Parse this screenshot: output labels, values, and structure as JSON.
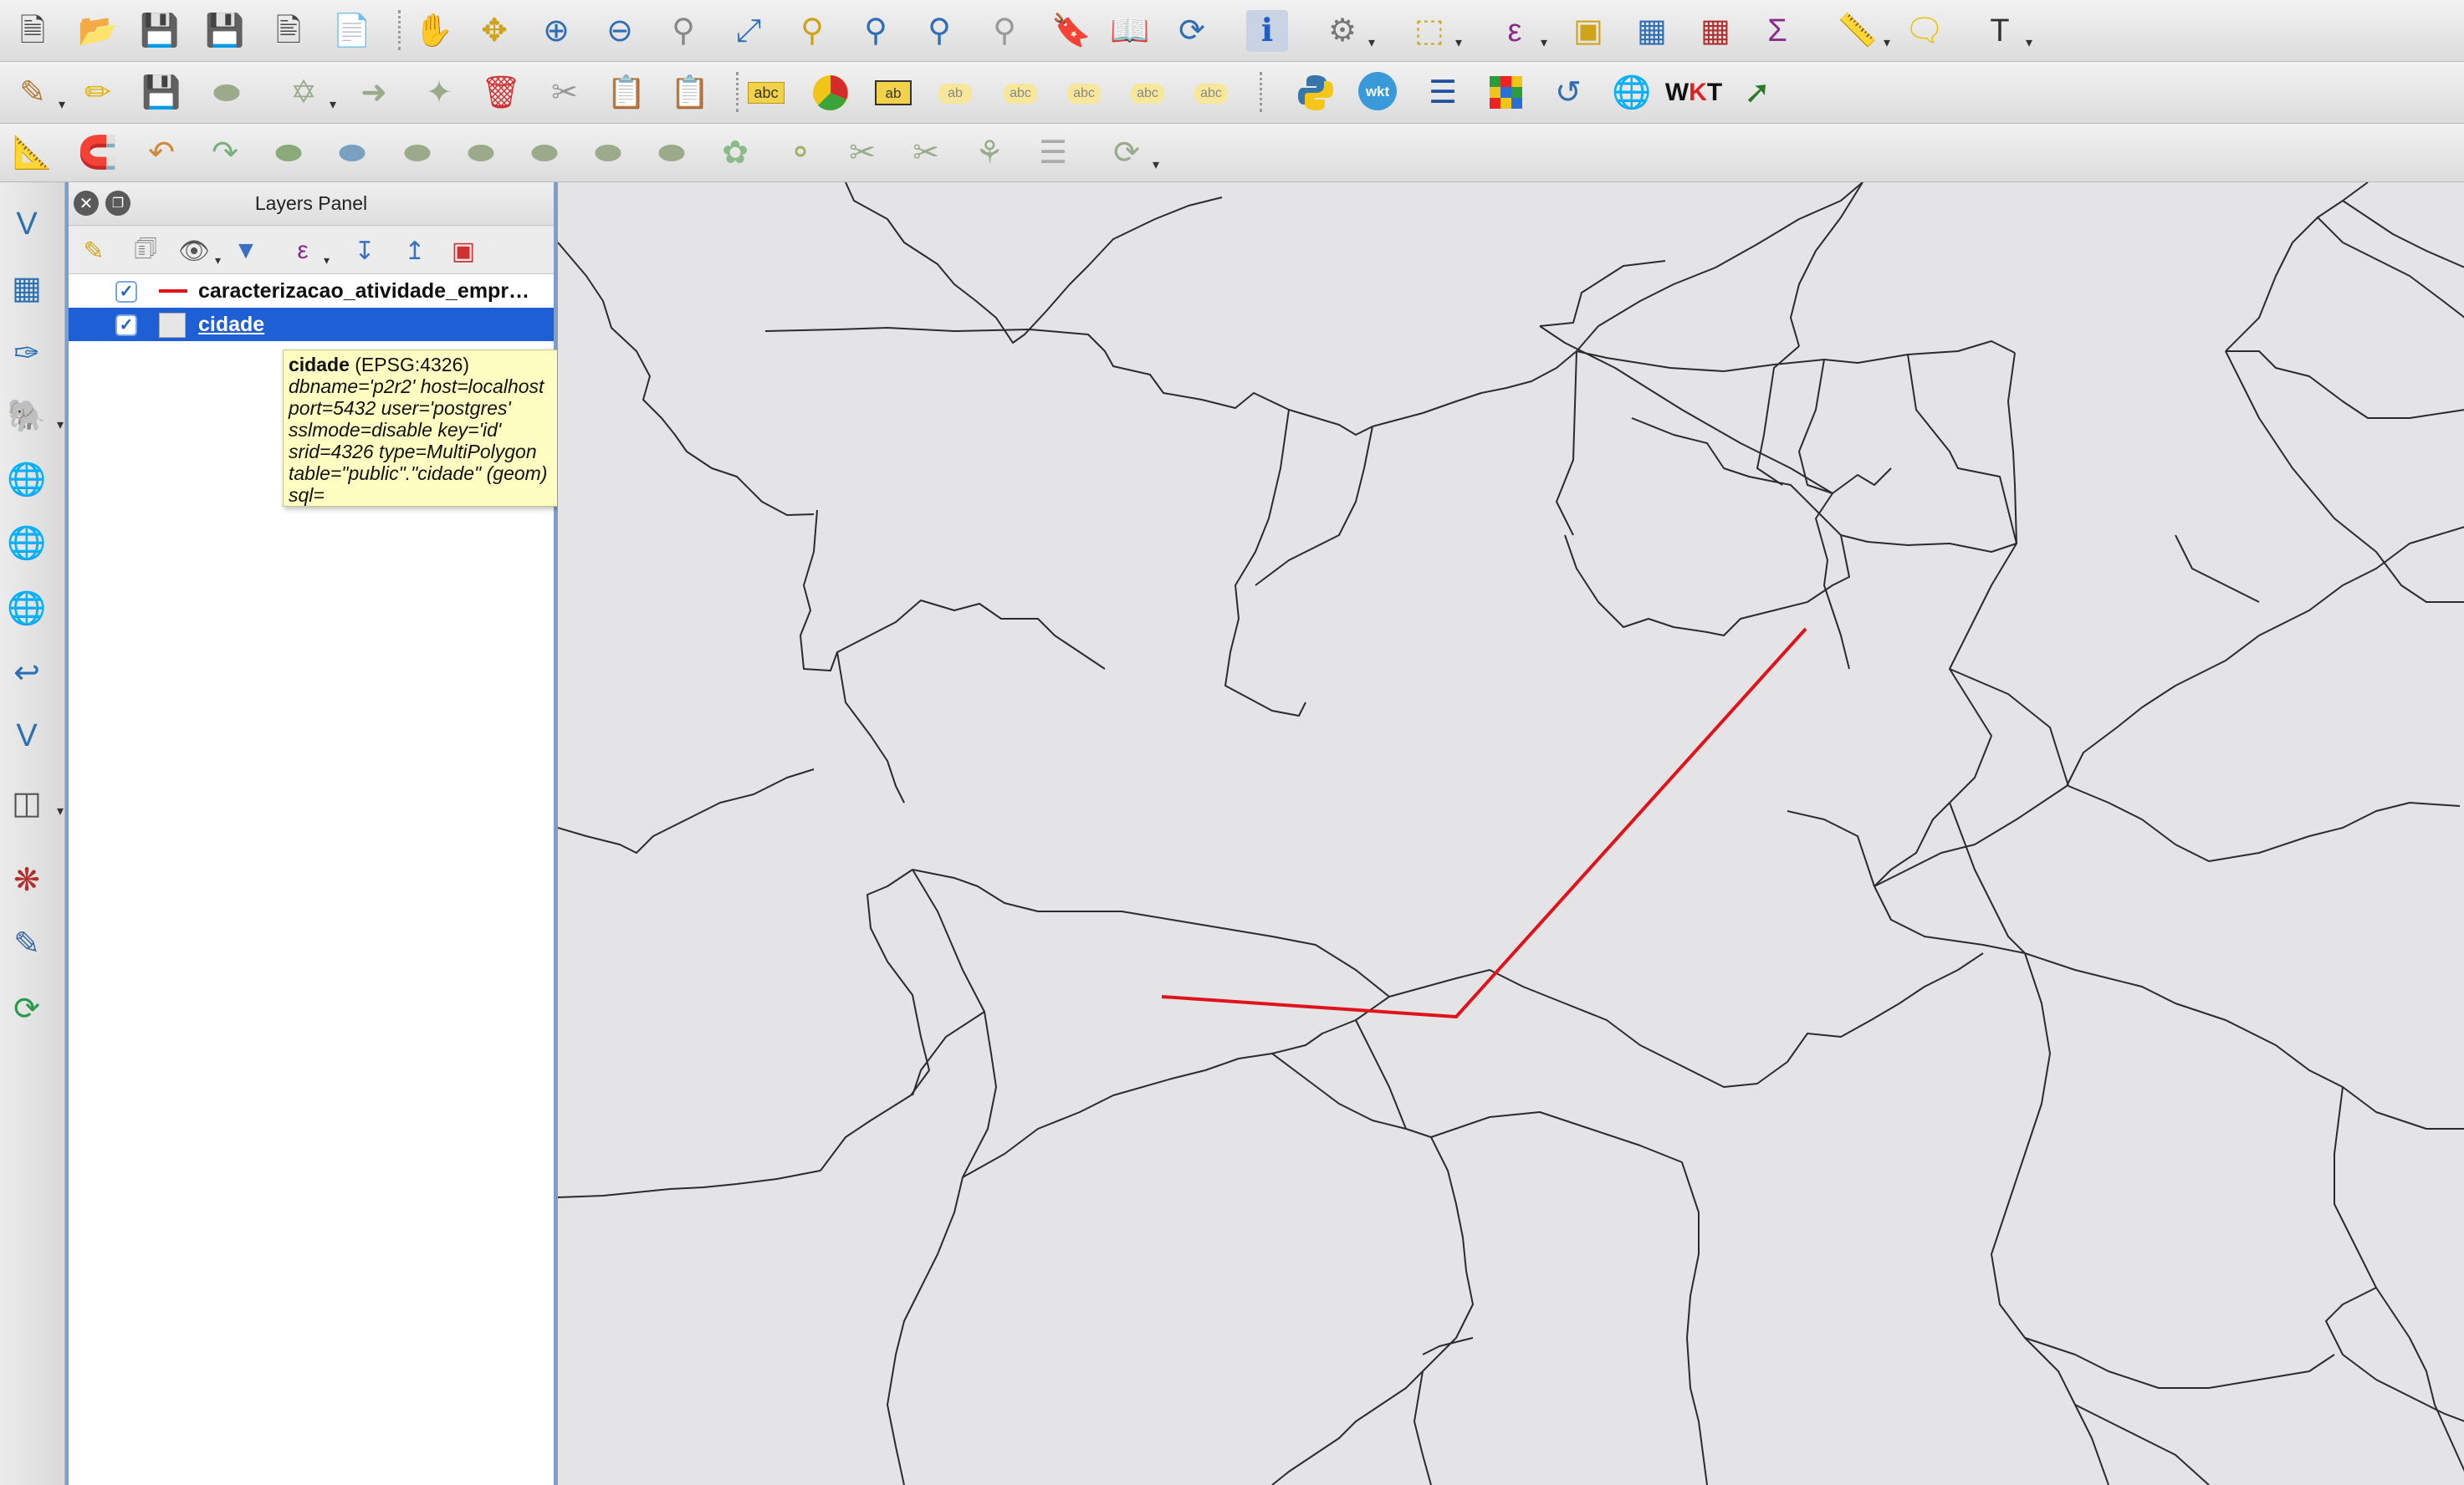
{
  "toolbar_icons": {
    "row1": [
      "new-project-icon",
      "open-project-icon",
      "save-project-icon",
      "save-as-icon",
      "new-print-composer-icon",
      "composer-manager-icon",
      "pan-icon",
      "pan-to-selection-icon",
      "zoom-in-icon",
      "zoom-out-icon",
      "zoom-native-icon",
      "zoom-full-icon",
      "zoom-to-selection-icon",
      "zoom-to-layer-icon",
      "zoom-last-icon",
      "zoom-next-icon",
      "new-bookmark-icon",
      "show-bookmarks-icon",
      "refresh-icon",
      "identify-icon",
      "action-icon",
      "select-features-icon",
      "select-by-expression-icon",
      "deselect-icon",
      "attribute-table-icon",
      "field-calculator-icon",
      "statistics-icon",
      "measure-icon",
      "map-tips-icon",
      "text-annotation-icon"
    ],
    "row2": [
      "current-edits-icon",
      "toggle-editing-icon",
      "save-edits-icon",
      "add-feature-icon",
      "move-feature-icon",
      "node-tool-icon",
      "delete-selected-icon",
      "cut-features-icon",
      "copy-features-icon",
      "paste-features-icon",
      "labeling-icon",
      "diagram-icon",
      "layer-labeling-icon",
      "pin-labels-icon",
      "show-hide-labels-icon",
      "move-label-icon",
      "rotate-label-icon",
      "change-label-icon",
      "python-icon",
      "wkt-icon",
      "plugin-stack-icon",
      "table-plugin-icon",
      "geocoder-icon",
      "globe-icon",
      "wkt-tool-icon",
      "vertex-arrow-icon"
    ],
    "row3": [
      "snapping-icon",
      "magnet-icon",
      "undo-icon",
      "redo-icon",
      "simplify-icon",
      "add-ring-icon",
      "add-part-icon",
      "fill-ring-icon",
      "delete-ring-icon",
      "delete-part-icon",
      "reshape-icon",
      "offset-curve-icon",
      "split-features-icon",
      "split-parts-icon",
      "merge-features-icon",
      "merge-attributes-icon",
      "rotate-point-symbols-icon"
    ]
  },
  "left_toolbar_icons": [
    "add-vector-layer-icon",
    "add-raster-layer-icon",
    "add-spatialite-layer-icon",
    "add-postgis-layer-icon",
    "add-wms-layer-icon",
    "add-wfs-layer-icon",
    "add-wcs-layer-icon",
    "add-delimited-text-icon",
    "add-virtual-layer-icon",
    "add-oracle-layer-icon",
    "new-shapefile-icon",
    "new-spatialite-icon",
    "new-temporary-layer-icon"
  ],
  "layers_panel": {
    "title": "Layers Panel",
    "layers": [
      {
        "name": "caracterizacao_atividade_empr…",
        "checked": true,
        "symbol": "line",
        "color": "#e0131b",
        "selected": false
      },
      {
        "name": "cidade",
        "checked": true,
        "symbol": "fill",
        "color": "#e6e6e6",
        "selected": true
      }
    ]
  },
  "tooltip": {
    "layer": "cidade",
    "crs": " (EPSG:4326)",
    "body": "dbname='p2r2' host=localhost\nport=5432 user='postgres'\nsslmode=disable key='id'\nsrid=4326 type=MultiPolygon\ntable=\"public\".\"cidade\" (geom)\nsql="
  },
  "colors": {
    "selection": "#1f5fd6",
    "line_layer": "#e0131b",
    "map_background": "#e4e4e6",
    "tooltip_background": "#fffec2"
  }
}
